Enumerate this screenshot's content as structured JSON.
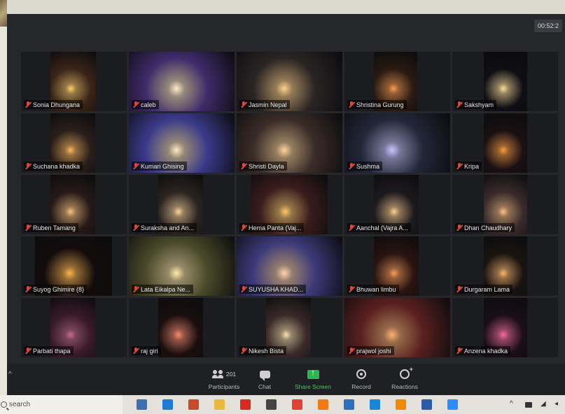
{
  "meeting": {
    "timer": "00:52:2"
  },
  "participants": [
    {
      "name": "Sonia Dhungana",
      "video": {
        "offset": 42,
        "width": 65,
        "glow": "#ffcc66",
        "bg": "#3a2418"
      }
    },
    {
      "name": "caleb",
      "video": {
        "offset": 0,
        "width": 151,
        "glow": "#ffe9c9",
        "bg": "#3f2b6a"
      }
    },
    {
      "name": "Jasmin Nepal",
      "video": {
        "offset": 0,
        "width": 151,
        "glow": "#ffd08a",
        "bg": "#2a2424"
      }
    },
    {
      "name": "Shristina Gurung",
      "video": {
        "offset": 42,
        "width": 62,
        "glow": "#ff9b4a",
        "bg": "#2a1a12"
      }
    },
    {
      "name": "Sakshyam",
      "video": {
        "offset": 45,
        "width": 62,
        "glow": "#ffdd99",
        "bg": "#0e0e14"
      }
    },
    {
      "name": "Suchana khadka",
      "video": {
        "offset": 42,
        "width": 64,
        "glow": "#ffb85a",
        "bg": "#2a1f1a"
      }
    },
    {
      "name": "Kumari Ghising",
      "video": {
        "offset": 0,
        "width": 151,
        "glow": "#ffe7c2",
        "bg": "#3b3a8a"
      }
    },
    {
      "name": "Shristi Dayla",
      "video": {
        "offset": 0,
        "width": 151,
        "glow": "#ffd29a",
        "bg": "#3a2c28"
      }
    },
    {
      "name": "Sushma",
      "video": {
        "offset": 0,
        "width": 151,
        "glow": "#c9c4ff",
        "bg": "#222738"
      }
    },
    {
      "name": "Kripa",
      "video": {
        "offset": 45,
        "width": 62,
        "glow": "#ff9a3c",
        "bg": "#1a1012"
      }
    },
    {
      "name": "Ruben Tamang",
      "video": {
        "offset": 42,
        "width": 64,
        "glow": "#ffc27a",
        "bg": "#261a18"
      }
    },
    {
      "name": "Suraksha and An...",
      "video": {
        "offset": 42,
        "width": 64,
        "glow": "#ffd39a",
        "bg": "#2b2420"
      }
    },
    {
      "name": "Hema Panta (Vaj...",
      "video": {
        "offset": 20,
        "width": 110,
        "glow": "#ffc76a",
        "bg": "#3a1c1c"
      }
    },
    {
      "name": "Aanchal (Vajra A...",
      "video": {
        "offset": 42,
        "width": 64,
        "glow": "#ffcf8f",
        "bg": "#1d1a1e"
      }
    },
    {
      "name": "Dhan Chaudhary",
      "video": {
        "offset": 45,
        "width": 62,
        "glow": "#ffc085",
        "bg": "#3a2b2b"
      }
    },
    {
      "name": "Suyog Ghimire (8)",
      "video": {
        "offset": 20,
        "width": 110,
        "glow": "#ffb347",
        "bg": "#140c0c"
      }
    },
    {
      "name": "Lata Eikalpa Ne...",
      "video": {
        "offset": 0,
        "width": 151,
        "glow": "#ffe9a8",
        "bg": "#4a4a2a"
      }
    },
    {
      "name": "SUYUSHA KHAD...",
      "video": {
        "offset": 0,
        "width": 151,
        "glow": "#ffd3b0",
        "bg": "#3d3a7a"
      }
    },
    {
      "name": "Bhuwan limbu",
      "video": {
        "offset": 42,
        "width": 64,
        "glow": "#ff9a55",
        "bg": "#2a1410"
      }
    },
    {
      "name": "Durgaram Lama",
      "video": {
        "offset": 45,
        "width": 62,
        "glow": "#ffb56b",
        "bg": "#1a1410"
      }
    },
    {
      "name": "Parbati thapa",
      "video": {
        "offset": 42,
        "width": 64,
        "glow": "#c86a8a",
        "bg": "#3a1a2a"
      }
    },
    {
      "name": "raj giri",
      "video": {
        "offset": 42,
        "width": 64,
        "glow": "#ff8a6a",
        "bg": "#1a0e0e"
      }
    },
    {
      "name": "Nikesh Bista",
      "video": {
        "offset": 42,
        "width": 64,
        "glow": "#ffe1b0",
        "bg": "#3a2a2a"
      }
    },
    {
      "name": "prajwol joshi",
      "video": {
        "offset": 0,
        "width": 151,
        "glow": "#ffb070",
        "bg": "#5a2020"
      }
    },
    {
      "name": "Anzena khadka",
      "video": {
        "offset": 45,
        "width": 62,
        "glow": "#ff6a9a",
        "bg": "#1a0e1a"
      }
    }
  ],
  "toolbar": {
    "participants_label": "Participants",
    "participants_count": "201",
    "chat_label": "Chat",
    "share_label": "Share Screen",
    "record_label": "Record",
    "reactions_label": "Reactions"
  },
  "taskbar": {
    "search_placeholder": "search",
    "apps": [
      {
        "name": "task-view-icon",
        "color": "#3c6fb5"
      },
      {
        "name": "mail-icon",
        "color": "#1f7ad1"
      },
      {
        "name": "powerpoint-icon",
        "color": "#c84a2a"
      },
      {
        "name": "file-explorer-icon",
        "color": "#e8b93a"
      },
      {
        "name": "acrobat-icon",
        "color": "#d62b1e"
      },
      {
        "name": "store-icon",
        "color": "#444444"
      },
      {
        "name": "chrome-icon",
        "color": "#e14133"
      },
      {
        "name": "firefox-icon",
        "color": "#f07a1a"
      },
      {
        "name": "photos-icon",
        "color": "#2a6fc0"
      },
      {
        "name": "edge-icon",
        "color": "#1a86d6"
      },
      {
        "name": "vlc-icon",
        "color": "#f08a00"
      },
      {
        "name": "word-icon",
        "color": "#2b5aa8"
      },
      {
        "name": "zoom-app-icon",
        "color": "#2d8cff"
      }
    ]
  }
}
